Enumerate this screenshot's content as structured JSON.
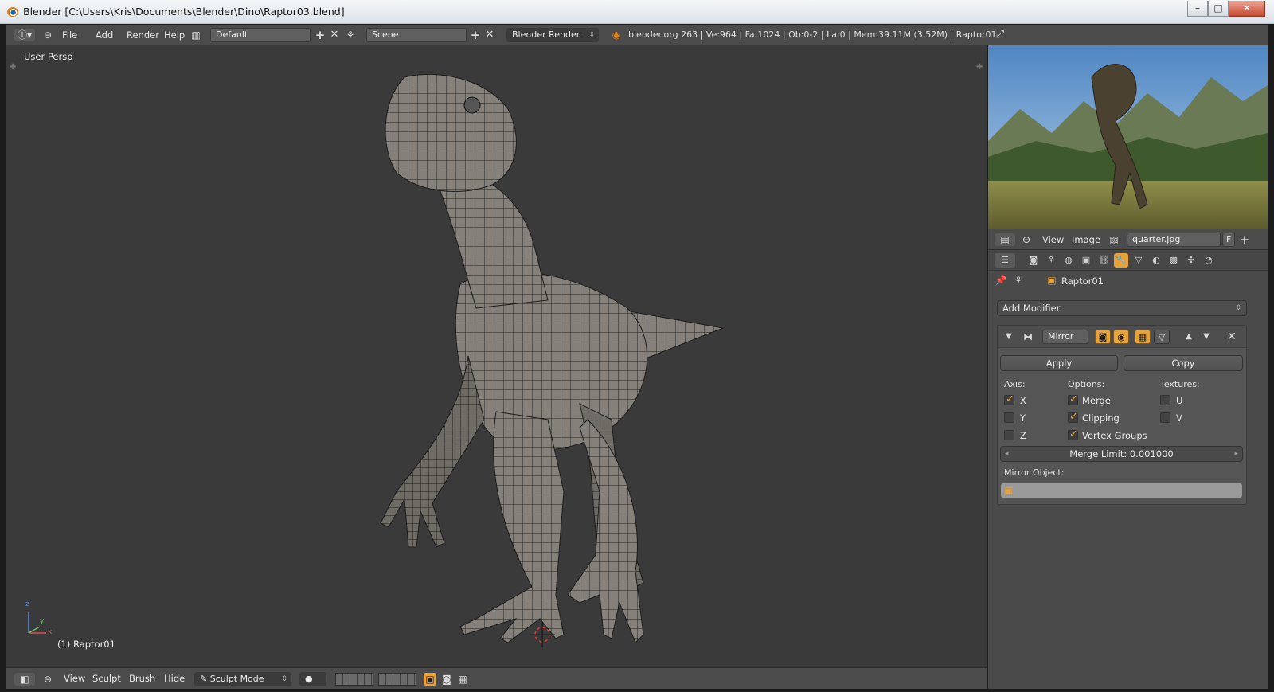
{
  "window": {
    "title": "Blender [C:\\Users\\Kris\\Documents\\Blender\\Dino\\Raptor03.blend]",
    "minimize": "–",
    "maximize": "□",
    "close": "✕"
  },
  "topbar": {
    "menus": [
      "File",
      "Add",
      "Render",
      "Help"
    ],
    "layout": "Default",
    "scene": "Scene",
    "engine": "Blender Render",
    "stats": "blender.org 263 | Ve:964 | Fa:1024 | Ob:0-2 | La:0 | Mem:39.11M (3.52M) | Raptor01"
  },
  "viewport": {
    "label": "User Persp",
    "object": "(1) Raptor01",
    "axis_x": "x",
    "axis_y": "y",
    "axis_z": "z"
  },
  "bottombar": {
    "menus": [
      "View",
      "Sculpt",
      "Brush",
      "Hide"
    ],
    "mode": "Sculpt Mode"
  },
  "image_editor": {
    "menus": [
      "View",
      "Image"
    ],
    "image": "quarter.jpg",
    "fake_user": "F"
  },
  "properties": {
    "object": "Raptor01",
    "add_modifier": "Add Modifier",
    "modifier_name": "Mirror",
    "apply": "Apply",
    "copy": "Copy",
    "axis_label": "Axis:",
    "options_label": "Options:",
    "textures_label": "Textures:",
    "axis": [
      {
        "label": "X",
        "checked": true
      },
      {
        "label": "Y",
        "checked": false
      },
      {
        "label": "Z",
        "checked": false
      }
    ],
    "options": [
      {
        "label": "Merge",
        "checked": true
      },
      {
        "label": "Clipping",
        "checked": true
      },
      {
        "label": "Vertex Groups",
        "checked": true
      }
    ],
    "textures": [
      {
        "label": "U",
        "checked": false
      },
      {
        "label": "V",
        "checked": false
      }
    ],
    "merge_limit": "Merge Limit: 0.001000",
    "mirror_object_label": "Mirror Object:"
  },
  "colors": {
    "accent": "#e8a23a",
    "viewport_bg": "#3a3a3a",
    "header_bg": "#4b4b4b"
  }
}
